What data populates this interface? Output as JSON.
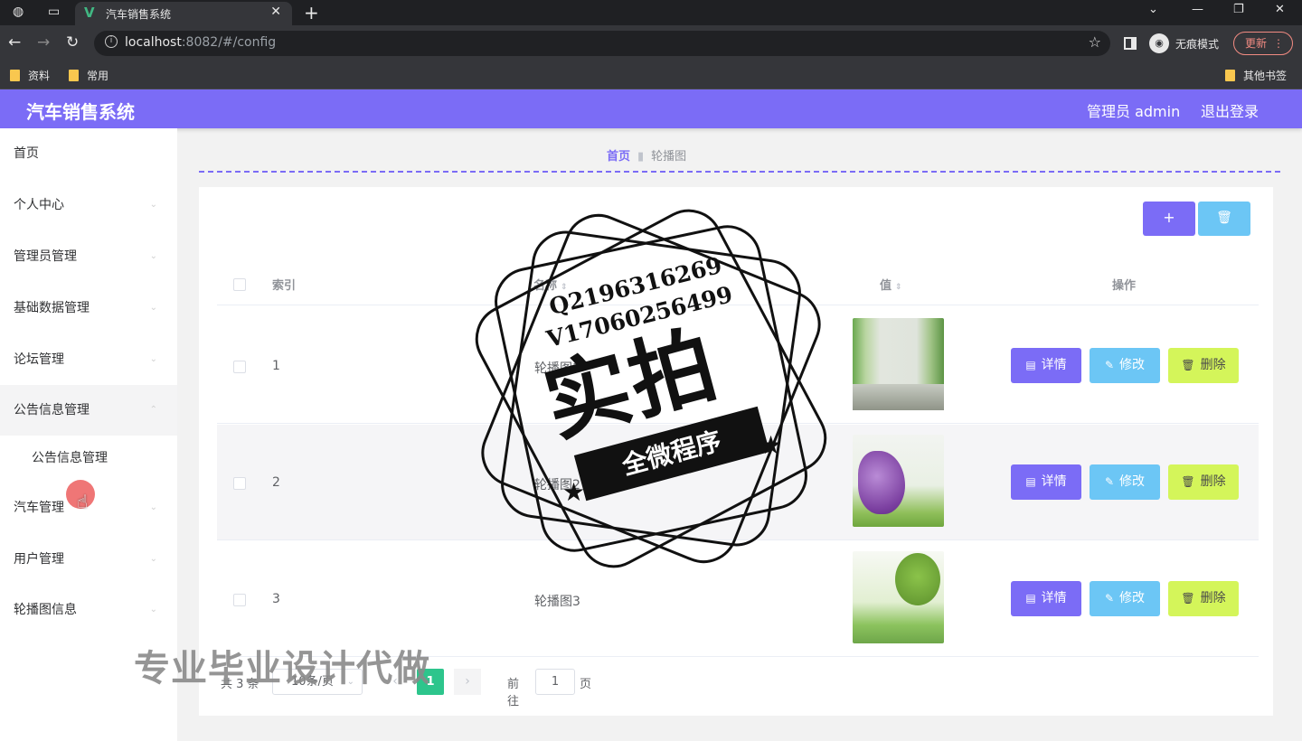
{
  "browser": {
    "tab_title": "汽车销售系统",
    "url_host": "localhost",
    "url_rest": ":8082/#/config",
    "incognito_label": "无痕模式",
    "update_label": "更新",
    "bookmarks": [
      "资料",
      "常用"
    ],
    "other_bookmarks": "其他书签"
  },
  "header": {
    "title": "汽车销售系统",
    "user_label": "管理员 admin",
    "logout_label": "退出登录"
  },
  "sidebar": {
    "items": [
      {
        "label": "首页"
      },
      {
        "label": "个人中心"
      },
      {
        "label": "管理员管理"
      },
      {
        "label": "基础数据管理"
      },
      {
        "label": "论坛管理"
      },
      {
        "label": "公告信息管理"
      },
      {
        "label": "汽车管理"
      },
      {
        "label": "用户管理"
      },
      {
        "label": "轮播图信息"
      }
    ],
    "submenu": [
      {
        "label": "公告信息管理"
      }
    ]
  },
  "breadcrumb": {
    "home": "首页",
    "current": "轮播图"
  },
  "toolbar": {
    "add_label": "+",
    "delete_icon": "trash-icon"
  },
  "table": {
    "columns": [
      "索引",
      "名称",
      "值",
      "操作"
    ],
    "rows": [
      {
        "index": "1",
        "name": "轮播图1",
        "image": "bamboo-forest-scene"
      },
      {
        "index": "2",
        "name": "轮播图2",
        "image": "purple-flowers-scene"
      },
      {
        "index": "3",
        "name": "轮播图3",
        "image": "tree-meadow-scene"
      }
    ],
    "actions": {
      "detail": "详情",
      "edit": "修改",
      "delete": "删除"
    }
  },
  "pagination": {
    "total": "共 3 条",
    "page_size": "10条/页",
    "current_page": "1",
    "goto_label": "前往",
    "goto_value": "1",
    "page_unit": "页"
  },
  "overlay": {
    "stamp_line1": "Q2196316269",
    "stamp_line2": "V17060256499",
    "stamp_big": "实拍",
    "stamp_ribbon": "全微程序",
    "watermark": "专业毕业设计代做"
  },
  "colors": {
    "primary": "#7b6cf6",
    "info": "#6cc6f5",
    "warning": "#d4f55a",
    "page_active": "#2dc58c"
  }
}
